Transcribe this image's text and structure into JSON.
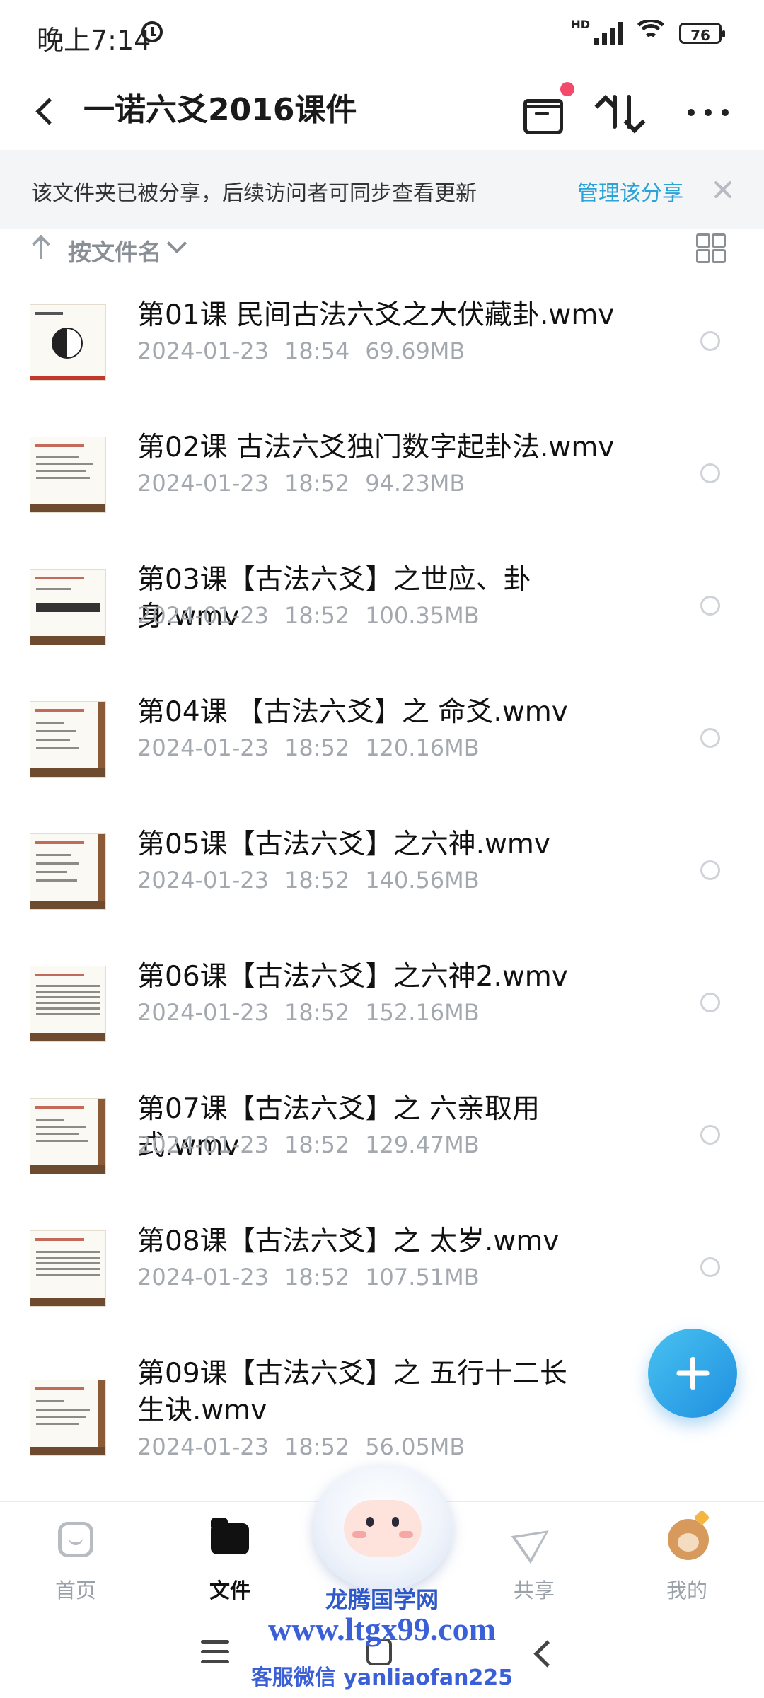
{
  "status_bar": {
    "time": "晚上7:14",
    "network": "HD",
    "battery": "76"
  },
  "header": {
    "back_icon": "back-arrow-icon",
    "title": "一诺六爻2016课件"
  },
  "share_banner": {
    "message": "该文件夹已被分享，后续访问者可同步查看更新",
    "manage_label": "管理该分享"
  },
  "sort_bar": {
    "label": "按文件名"
  },
  "files": [
    {
      "name": "第01课  民间古法六爻之大伏藏卦.wmv",
      "date": "2024-01-23",
      "time": "18:54",
      "size": "69.69MB"
    },
    {
      "name": "第02课  古法六爻独门数字起卦法.wmv",
      "date": "2024-01-23",
      "time": "18:52",
      "size": "94.23MB"
    },
    {
      "name": "第03课【古法六爻】之世应、卦身.wmv",
      "date": "2024-01-23",
      "time": "18:52",
      "size": "100.35MB"
    },
    {
      "name": "第04课  【古法六爻】之 命爻.wmv",
      "date": "2024-01-23",
      "time": "18:52",
      "size": "120.16MB"
    },
    {
      "name": "第05课【古法六爻】之六神.wmv",
      "date": "2024-01-23",
      "time": "18:52",
      "size": "140.56MB"
    },
    {
      "name": "第06课【古法六爻】之六神2.wmv",
      "date": "2024-01-23",
      "time": "18:52",
      "size": "152.16MB"
    },
    {
      "name": "第07课【古法六爻】之 六亲取用式.wmv",
      "date": "2024-01-23",
      "time": "18:52",
      "size": "129.47MB"
    },
    {
      "name": "第08课【古法六爻】之 太岁.wmv",
      "date": "2024-01-23",
      "time": "18:52",
      "size": "107.51MB"
    },
    {
      "name": "第09课【古法六爻】之 五行十二长生诀.wmv",
      "date": "2024-01-23",
      "time": "18:52",
      "size": "56.05MB"
    }
  ],
  "bottom_nav": {
    "home": "首页",
    "files": "文件",
    "share": "共享",
    "me": "我的"
  },
  "watermark": {
    "line1": "龙腾国学网",
    "line2": "www.ltgx99.com",
    "line3": "客服微信 yanliaofan225"
  },
  "colors": {
    "accent": "#2aa3d8",
    "fab": "#1f8fe0",
    "badge": "#f44a6a"
  }
}
